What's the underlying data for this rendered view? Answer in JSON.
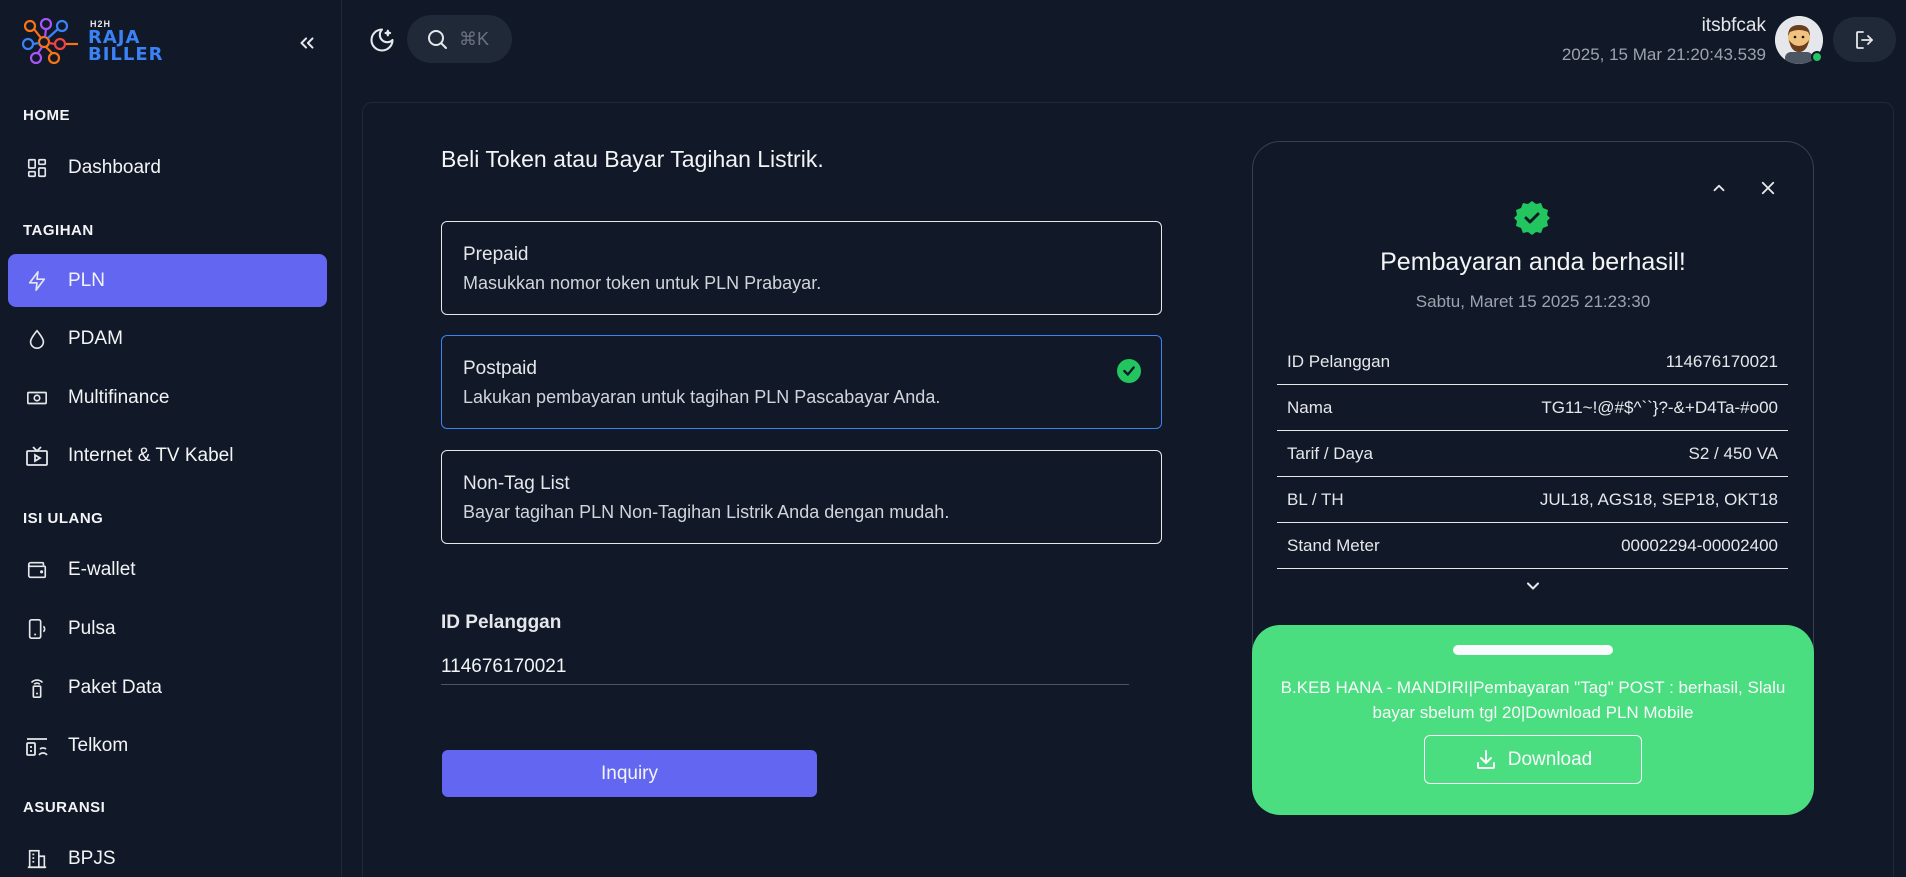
{
  "brand": {
    "small": "H2H",
    "line1": "RAJA",
    "line2": "BILLER"
  },
  "sidebar": {
    "sections": [
      {
        "label": "HOME",
        "items": [
          {
            "label": "Dashboard",
            "icon": "dashboard-icon"
          }
        ]
      },
      {
        "label": "TAGIHAN",
        "items": [
          {
            "label": "PLN",
            "icon": "lightning-icon",
            "active": true
          },
          {
            "label": "PDAM",
            "icon": "water-drop-icon"
          },
          {
            "label": "Multifinance",
            "icon": "banknote-icon"
          },
          {
            "label": "Internet & TV Kabel",
            "icon": "tv-icon"
          }
        ]
      },
      {
        "label": "ISI ULANG",
        "items": [
          {
            "label": "E-wallet",
            "icon": "wallet-icon"
          },
          {
            "label": "Pulsa",
            "icon": "phone-icon"
          },
          {
            "label": "Paket Data",
            "icon": "signal-tower-icon"
          },
          {
            "label": "Telkom",
            "icon": "telephone-icon"
          }
        ]
      },
      {
        "label": "ASURANSI",
        "items": [
          {
            "label": "BPJS",
            "icon": "building-icon"
          }
        ]
      }
    ]
  },
  "topbar": {
    "search_shortcut": "⌘K",
    "user_name": "itsbfcak",
    "timestamp": "2025, 15 Mar 21:20:43.539",
    "online_color": "#22c55e"
  },
  "main": {
    "title": "Beli Token atau Bayar Tagihan Listrik.",
    "options": [
      {
        "title": "Prepaid",
        "desc": "Masukkan nomor token untuk PLN Prabayar.",
        "selected": false
      },
      {
        "title": "Postpaid",
        "desc": "Lakukan pembayaran untuk tagihan PLN Pascabayar Anda.",
        "selected": true
      },
      {
        "title": "Non-Tag List",
        "desc": "Bayar tagihan PLN Non-Tagihan Listrik Anda dengan mudah.",
        "selected": false
      }
    ],
    "field_label": "ID Pelanggan",
    "field_value": "114676170021",
    "inquiry_label": "Inquiry"
  },
  "receipt": {
    "title": "Pembayaran anda berhasil!",
    "date": "Sabtu, Maret 15 2025 21:23:30",
    "rows": [
      {
        "label": "ID Pelanggan",
        "value": "114676170021"
      },
      {
        "label": "Nama",
        "value": "TG11~!@#$^``}?-&+D4Ta-#o00"
      },
      {
        "label": "Tarif / Daya",
        "value": "S2 / 450 VA"
      },
      {
        "label": "BL / TH",
        "value": "JUL18, AGS18, SEP18, OKT18"
      },
      {
        "label": "Stand Meter",
        "value": "00002294-00002400"
      }
    ],
    "message": "B.KEB HANA - MANDIRI|Pembayaran \"Tag\" POST : berhasil, Slalu bayar sbelum tgl 20|Download PLN Mobile",
    "download_label": "Download",
    "success_color": "#22c55e",
    "footer_color": "#4ade80"
  },
  "colors": {
    "accent": "#6366f1",
    "background": "#111827"
  }
}
